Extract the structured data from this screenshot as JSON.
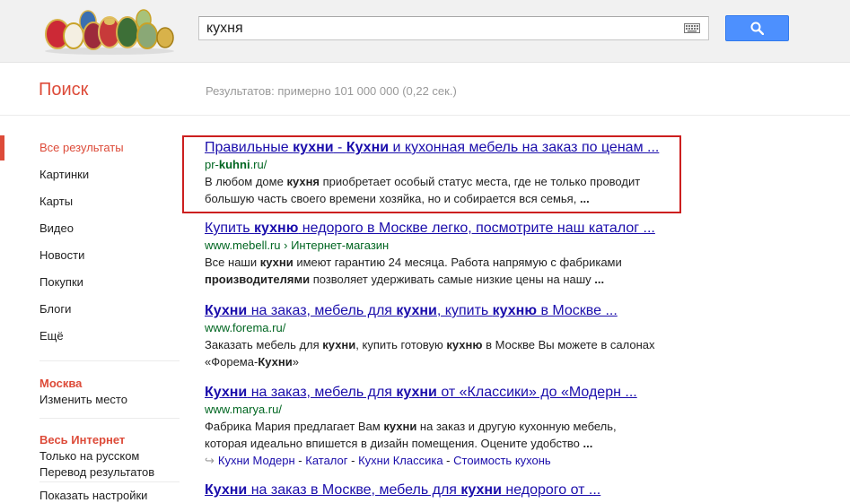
{
  "search": {
    "query": "кухня"
  },
  "brand": "Поиск",
  "stats": "Результатов: примерно 101 000 000 (0,22 сек.)",
  "nav": [
    "Все результаты",
    "Картинки",
    "Карты",
    "Видео",
    "Новости",
    "Покупки",
    "Блоги",
    "Ещё"
  ],
  "location": {
    "title": "Москва",
    "change": "Изменить место"
  },
  "scope": {
    "title": "Весь Интернет",
    "items": [
      "Только на русском",
      "Перевод результатов"
    ]
  },
  "settings": "Показать настройки",
  "results": [
    {
      "title": [
        [
          "Правильные ",
          false
        ],
        [
          "кухни",
          true
        ],
        [
          " - ",
          false
        ],
        [
          "Кухни",
          true
        ],
        [
          " и кухонная мебель на заказ по ценам ...",
          false
        ]
      ],
      "url": [
        [
          "pr-",
          false
        ],
        [
          "kuhni",
          true
        ],
        [
          ".ru/",
          false
        ]
      ],
      "snippet": [
        [
          [
            "В любом доме ",
            false
          ],
          [
            "кухня",
            true
          ],
          [
            " приобретает особый статус места, где не только проводит",
            false
          ]
        ],
        [
          [
            "большую часть своего времени хозяйка, но и собирается вся семья, ",
            false
          ],
          [
            "...",
            true
          ]
        ]
      ]
    },
    {
      "title": [
        [
          "Купить ",
          false
        ],
        [
          "кухню",
          true
        ],
        [
          " недорого в Москве легко, посмотрите наш каталог ...",
          false
        ]
      ],
      "url": [
        [
          "www.mebell.ru › Интернет-магазин",
          false
        ]
      ],
      "snippet": [
        [
          [
            "Все наши ",
            false
          ],
          [
            "кухни",
            true
          ],
          [
            " имеют гарантию 24 месяца. Работа напрямую с фабриками",
            false
          ]
        ],
        [
          [
            "производителями",
            true
          ],
          [
            " позволяет удерживать самые низкие цены на нашу ",
            false
          ],
          [
            "...",
            true
          ]
        ]
      ]
    },
    {
      "title": [
        [
          "Кухни",
          true
        ],
        [
          " на заказ, мебель для ",
          false
        ],
        [
          "кухни",
          true
        ],
        [
          ", купить ",
          false
        ],
        [
          "кухню",
          true
        ],
        [
          " в Москве ...",
          false
        ]
      ],
      "url": [
        [
          "www.forema.ru/",
          false
        ]
      ],
      "snippet": [
        [
          [
            "Заказать мебель для ",
            false
          ],
          [
            "кухни",
            true
          ],
          [
            ", купить готовую ",
            false
          ],
          [
            "кухню",
            true
          ],
          [
            " в Москве Вы можете в салонах",
            false
          ]
        ],
        [
          [
            "«Форема-",
            false
          ],
          [
            "Кухни",
            true
          ],
          [
            "»",
            false
          ]
        ]
      ]
    },
    {
      "title": [
        [
          "Кухни",
          true
        ],
        [
          " на заказ, мебель для ",
          false
        ],
        [
          "кухни",
          true
        ],
        [
          " от «Классики» до «Модерн ...",
          false
        ]
      ],
      "url": [
        [
          "www.marya.ru/",
          false
        ]
      ],
      "snippet": [
        [
          [
            "Фабрика Мария предлагает Вам ",
            false
          ],
          [
            "кухни",
            true
          ],
          [
            " на заказ и другую кухонную мебель,",
            false
          ]
        ],
        [
          [
            "которая идеально впишется в дизайн помещения. Оцените удобство ",
            false
          ],
          [
            "...",
            true
          ]
        ]
      ],
      "sitelinks": [
        "Кухни Модерн",
        "Каталог",
        "Кухни Классика",
        "Стоимость кухонь"
      ]
    },
    {
      "title": [
        [
          "Кухни",
          true
        ],
        [
          " на заказ в Москве, мебель для ",
          false
        ],
        [
          "кухни",
          true
        ],
        [
          " недорого от ...",
          false
        ]
      ],
      "url": [],
      "snippet": []
    }
  ],
  "colors": {
    "link": "#1a0dab",
    "url": "#006621",
    "accent": "#dd4b39",
    "search_button": "#4d90fe",
    "highlight": "#cc1f1f"
  },
  "icons": [
    "faberge-eggs-logo",
    "keyboard-icon",
    "search-icon",
    "sitelink-arrow-icon"
  ]
}
